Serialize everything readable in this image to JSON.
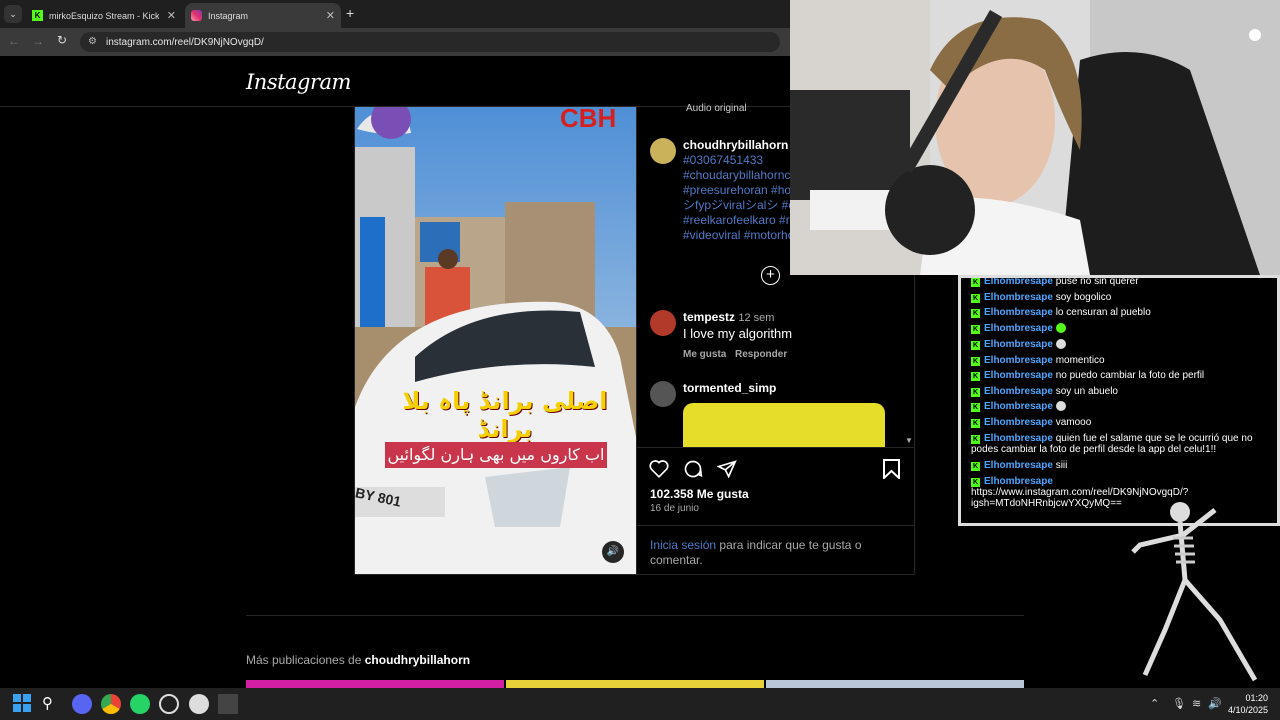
{
  "browser": {
    "tabs": [
      {
        "label": "mirkoEsquizo Stream - Kick Da"
      },
      {
        "label": "Instagram"
      }
    ],
    "url": "instagram.com/reel/DK9NjNOvgqD/"
  },
  "instagram": {
    "logo": "Instagram",
    "audio_label": "Audio original",
    "caption_user": "choudhrybillahorn",
    "caption_lines": [
      "#03067451433",
      "#choudarybillahorncl",
      "#preesurehoran #hor",
      "シfypジviralシalシ #c",
      "#reelkarofeelkaro #re",
      "#videoviral #motorho"
    ],
    "media_text_top": "CBH",
    "media_text_urdu_1": "اصلی برانڈ پاہ بلا برانڈ",
    "media_text_urdu_2": "اب کاروں میں بھی ہارن لگوائیں",
    "plate": "BY 801",
    "comments": [
      {
        "user": "tempestz",
        "time": "12 sem",
        "text": "I love my algorithm",
        "like": "Me gusta",
        "reply": "Responder"
      },
      {
        "user": "tormented_simp"
      }
    ],
    "likes": "102.358 Me gusta",
    "date": "16 de junio",
    "login_link": "Inicia sesión",
    "login_text": "para indicar que te gusta o comentar.",
    "more_posts_prefix": "Más publicaciones de",
    "more_posts_user": "choudhrybillahorn"
  },
  "chat": {
    "partial_top": "pusé no sin querer",
    "messages": [
      {
        "user": "Elhombresape",
        "text": "soy bogolico"
      },
      {
        "user": "Elhombresape",
        "text": "lo censuran al pueblo"
      },
      {
        "user": "Elhombresape",
        "text": ""
      },
      {
        "user": "Elhombresape",
        "text": ""
      },
      {
        "user": "Elhombresape",
        "text": "momentico"
      },
      {
        "user": "Elhombresape",
        "text": "no puedo cambiar la foto de perfil"
      },
      {
        "user": "Elhombresape",
        "text": "soy un abuelo"
      },
      {
        "user": "Elhombresape",
        "text": ""
      },
      {
        "user": "Elhombresape",
        "text": "vamooo"
      },
      {
        "user": "Elhombresape",
        "text": "quien fue el salame que se le ocurrió que no"
      },
      {
        "user": "",
        "text": "podes cambiar la foto de perfil desde la app del celu!1!!"
      },
      {
        "user": "Elhombresape",
        "text": "siii"
      },
      {
        "user": "Elhombresape",
        "text": ""
      },
      {
        "user": "",
        "text": "https://www.instagram.com/reel/DK9NjNOvgqD/?"
      },
      {
        "user": "",
        "text": "igsh=MTdoNHRnbjcwYXQyMQ=="
      }
    ]
  },
  "taskbar": {
    "time": "01:20",
    "date": "4/10/2025"
  },
  "colors": {
    "instagram_link": "#4f7ac7",
    "kick_green": "#53fc18",
    "chat_name": "#4da6ff"
  }
}
